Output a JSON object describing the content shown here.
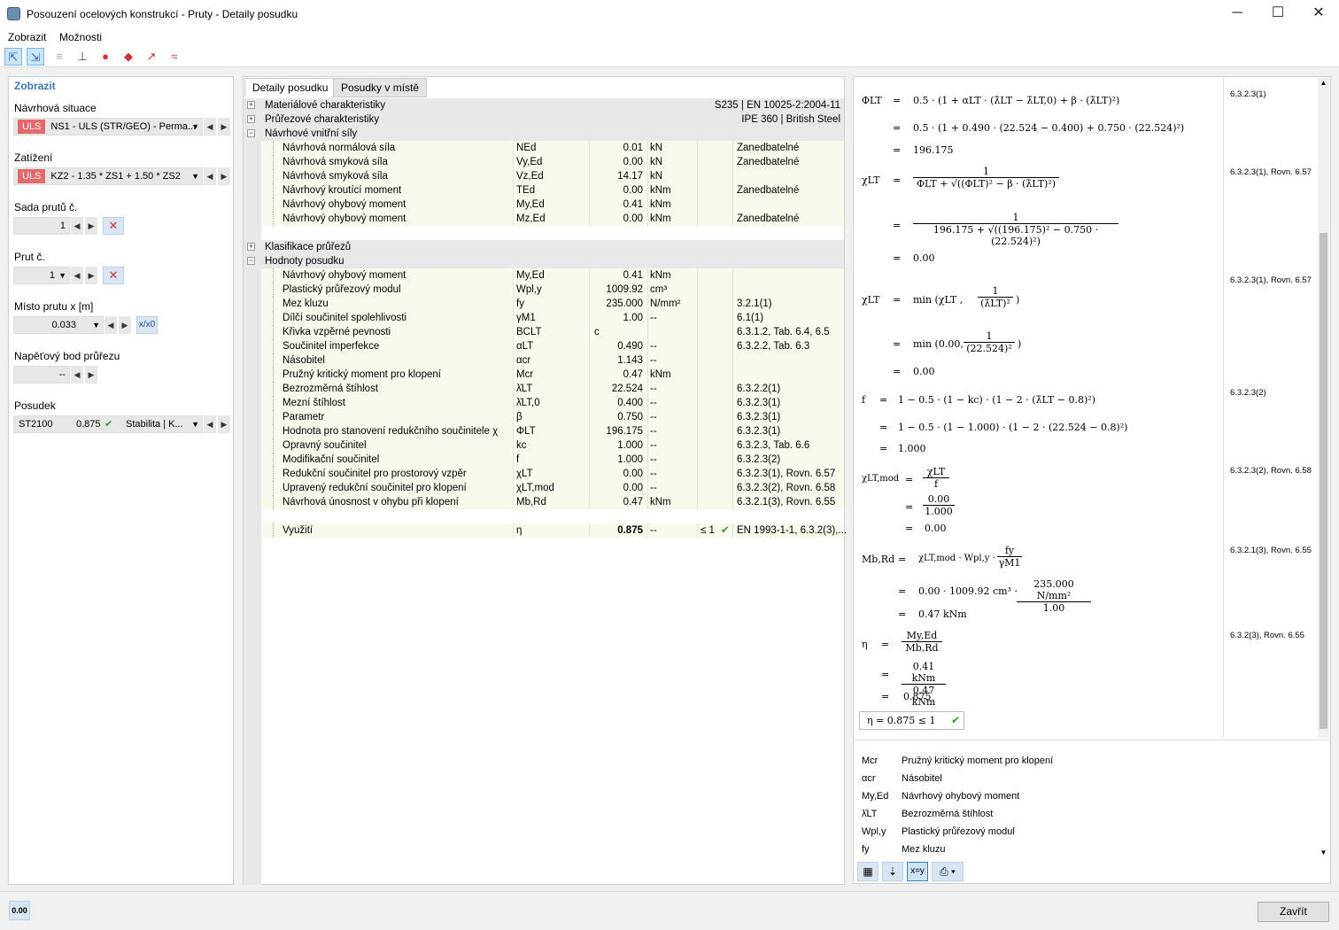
{
  "window": {
    "title": "Posouzení ocelových konstrukcí - Pruty - Detaily posudku"
  },
  "menu": [
    "Zobrazit",
    "Možnosti"
  ],
  "toolbar": {
    "icons": [
      "select-icon",
      "select-multiple-icon",
      "align-icon",
      "member-icon",
      "results-icon",
      "design-check-icon",
      "graph-icon",
      "section-icon"
    ]
  },
  "left": {
    "header": "Zobrazit",
    "design_situation_label": "Návrhová situace",
    "design_situation_tag": "ULS",
    "design_situation_value": "NS1 - ULS (STR/GEO) - Perma...",
    "loading_label": "Zatížení",
    "loading_tag": "ULS",
    "loading_value": "KZ2 - 1.35 * ZS1 + 1.50 * ZS2",
    "member_set_label": "Sada prutů č.",
    "member_set_value": "1",
    "member_label": "Prut č.",
    "member_value": "1",
    "location_label": "Místo prutu x [m]",
    "location_value": "0.033",
    "location_toggle": "x/x0",
    "stress_point_label": "Napěťový bod průřezu",
    "stress_point_value": "--",
    "check_label": "Posudek",
    "check_id": "ST2100",
    "check_ratio": "0.875",
    "check_type": "Stabilita | K..."
  },
  "tabs": [
    "Detaily posudku",
    "Posudky v místě"
  ],
  "sections": [
    {
      "label": "Materiálové charakteristiky",
      "right": "S235 | EN 10025-2:2004-11",
      "expanded": false
    },
    {
      "label": "Průřezové charakteristiky",
      "right": "IPE 360 | British Steel",
      "expanded": false
    },
    {
      "label": "Návrhové vnitřní síly",
      "right": "",
      "expanded": true
    },
    {
      "label": "Klasifikace průřezů",
      "right": "",
      "expanded": false
    },
    {
      "label": "Hodnoty posudku",
      "right": "",
      "expanded": true
    }
  ],
  "forces": [
    {
      "desc": "Návrhová normálová síla",
      "sym": "NEd",
      "val": "0.01",
      "unit": "kN",
      "note": "Zanedbatelné"
    },
    {
      "desc": "Návrhová smyková síla",
      "sym": "Vy,Ed",
      "val": "0.00",
      "unit": "kN",
      "note": "Zanedbatelné"
    },
    {
      "desc": "Návrhová smyková síla",
      "sym": "Vz,Ed",
      "val": "14.17",
      "unit": "kN",
      "note": ""
    },
    {
      "desc": "Návrhový kroutící moment",
      "sym": "TEd",
      "val": "0.00",
      "unit": "kNm",
      "note": "Zanedbatelné"
    },
    {
      "desc": "Návrhový ohybový moment",
      "sym": "My,Ed",
      "val": "0.41",
      "unit": "kNm",
      "note": ""
    },
    {
      "desc": "Návrhový ohybový moment",
      "sym": "Mz,Ed",
      "val": "0.00",
      "unit": "kNm",
      "note": "Zanedbatelné"
    }
  ],
  "values": [
    {
      "desc": "Návrhový ohybový moment",
      "sym": "My,Ed",
      "val": "0.41",
      "unit": "kNm",
      "ref": ""
    },
    {
      "desc": "Plastický průřezový modul",
      "sym": "Wpl,y",
      "val": "1009.92",
      "unit": "cm³",
      "ref": ""
    },
    {
      "desc": "Mez kluzu",
      "sym": "fy",
      "val": "235.000",
      "unit": "N/mm²",
      "ref": "3.2.1(1)"
    },
    {
      "desc": "Dílčí součinitel spolehlivosti",
      "sym": "γM1",
      "val": "1.00",
      "unit": "--",
      "ref": "6.1(1)"
    },
    {
      "desc": "Křivka vzpěrné pevnosti",
      "sym": "BCLT",
      "val": "c",
      "unit": "",
      "ref": "6.3.1.2, Tab. 6.4, 6.5"
    },
    {
      "desc": "Součinitel imperfekce",
      "sym": "αLT",
      "val": "0.490",
      "unit": "--",
      "ref": "6.3.2.2, Tab. 6.3"
    },
    {
      "desc": "Násobitel",
      "sym": "αcr",
      "val": "1.143",
      "unit": "--",
      "ref": ""
    },
    {
      "desc": "Pružný kritický moment pro klopení",
      "sym": "Mcr",
      "val": "0.47",
      "unit": "kNm",
      "ref": ""
    },
    {
      "desc": "Bezrozměrná štíhlost",
      "sym": "λ̄LT",
      "val": "22.524",
      "unit": "--",
      "ref": "6.3.2.2(1)"
    },
    {
      "desc": "Mezní štíhlost",
      "sym": "λ̄LT,0",
      "val": "0.400",
      "unit": "--",
      "ref": "6.3.2.3(1)"
    },
    {
      "desc": "Parametr",
      "sym": "β",
      "val": "0.750",
      "unit": "--",
      "ref": "6.3.2.3(1)"
    },
    {
      "desc": "Hodnota pro stanovení redukčního součinitele χ",
      "sym": "ΦLT",
      "val": "196.175",
      "unit": "--",
      "ref": "6.3.2.3(1)"
    },
    {
      "desc": "Opravný součinitel",
      "sym": "kc",
      "val": "1.000",
      "unit": "--",
      "ref": "6.3.2.3, Tab. 6.6"
    },
    {
      "desc": "Modifikační součinitel",
      "sym": "f",
      "val": "1.000",
      "unit": "--",
      "ref": "6.3.2.3(2)"
    },
    {
      "desc": "Redukční součinitel pro prostorový vzpěr",
      "sym": "χLT",
      "val": "0.00",
      "unit": "--",
      "ref": "6.3.2.3(1), Rovn. 6.57"
    },
    {
      "desc": "Upravený redukční součinitel pro klopení",
      "sym": "χLT,mod",
      "val": "0.00",
      "unit": "--",
      "ref": "6.3.2.3(2), Rovn. 6.58"
    },
    {
      "desc": "Návrhová únosnost v ohybu při klopení",
      "sym": "Mb,Rd",
      "val": "0.47",
      "unit": "kNm",
      "ref": "6.3.2.1(3), Rovn. 6.55"
    }
  ],
  "utilization": {
    "desc": "Využití",
    "sym": "η",
    "val": "0.875",
    "unit": "--",
    "limit": "≤ 1",
    "ref": "EN 1993-1-1, 6.3.2(3),..."
  },
  "formulas": {
    "phi_lhs": "ΦLT",
    "phi_l1": "0.5 · (1 + αLT · (λ̄LT − λ̄LT,0) + β · (λ̄LT)²)",
    "phi_l2": "0.5 · (1 + 0.490 · (22.524 − 0.400) + 0.750 · (22.524)²)",
    "phi_res": "196.175",
    "phi_ref": "6.3.2.3(1)",
    "chi_lhs": "χLT",
    "chi_num": "1",
    "chi_den1": "ΦLT + √((ΦLT)² − β · (λ̄LT)²)",
    "chi_den2": "196.175 + √((196.175)² − 0.750 · (22.524)²)",
    "chi_res": "0.00",
    "chi_ref": "6.3.2.3(1), Rovn. 6.57",
    "chimin_lhs": "χLT",
    "chimin_l1a": "min (χLT ,",
    "chimin_num": "1",
    "chimin_den": "(λ̄LT)²",
    "chimin_l2a": "min (0.00,",
    "chimin_den2": "(22.524)²",
    "chimin_res": "0.00",
    "chimin_ref": "6.3.2.3(1), Rovn. 6.57",
    "f_lhs": "f",
    "f_l1": "1 − 0.5 · (1 − kc) · (1 − 2 · (λ̄LT − 0.8)²)",
    "f_l2": "1 − 0.5 · (1 − 1.000) · (1 − 2 · (22.524 − 0.8)²)",
    "f_res": "1.000",
    "f_ref": "6.3.2.3(2)",
    "chimod_lhs": "χLT,mod",
    "chimod_num": "χLT",
    "chimod_den": "f",
    "chimod_num2": "0.00",
    "chimod_den2": "1.000",
    "chimod_res": "0.00",
    "chimod_ref": "6.3.2.3(2), Rovn. 6.58",
    "mb_lhs": "Mb,Rd",
    "mb_l1": "χLT,mod · Wpl,y ·",
    "mb_fnum": "fy",
    "mb_fden": "γM1",
    "mb_l2": "0.00 · 1009.92 cm³ ·",
    "mb_fnum2": "235.000 N/mm²",
    "mb_fden2": "1.00",
    "mb_res": "0.47 kNm",
    "mb_ref": "6.3.2.1(3), Rovn. 6.55",
    "eta_lhs": "η",
    "eta_num": "My,Ed",
    "eta_den": "Mb,Rd",
    "eta_num2": "0.41 kNm",
    "eta_den2": "0.47 kNm",
    "eta_res": "0.875",
    "eta_ref": "6.3.2(3), Rovn. 6.55",
    "final": "η = 0.875 ≤ 1"
  },
  "legend": [
    {
      "sym": "Mcr",
      "desc": "Pružný kritický moment pro klopení"
    },
    {
      "sym": "αcr",
      "desc": "Násobitel"
    },
    {
      "sym": "My,Ed",
      "desc": "Návrhový ohybový moment"
    },
    {
      "sym": "λ̄LT",
      "desc": "Bezrozměrná štíhlost"
    },
    {
      "sym": "Wpl,y",
      "desc": "Plastický průřezový modul"
    },
    {
      "sym": "fy",
      "desc": "Mez kluzu"
    }
  ],
  "status": {
    "decimals": "0.00"
  },
  "close_button": "Zavřít"
}
